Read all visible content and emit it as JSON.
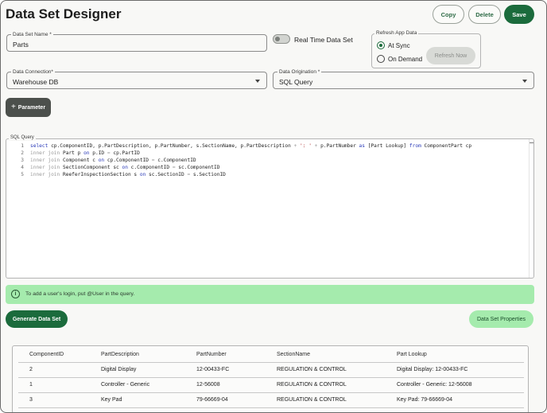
{
  "header": {
    "title": "Data Set Designer",
    "copy_label": "Copy",
    "delete_label": "Delete",
    "save_label": "Save"
  },
  "form": {
    "dataset_name": {
      "label": "Data Set Name *",
      "value": "Parts"
    },
    "realtime": {
      "label": "Real Time Data Set",
      "enabled": false
    },
    "refresh": {
      "title": "Refresh App Data",
      "options": [
        {
          "label": "At Sync",
          "selected": true
        },
        {
          "label": "On Demand",
          "selected": false
        }
      ],
      "refresh_now_label": "Refresh Now"
    },
    "data_connection": {
      "label": "Data Connection*",
      "value": "Warehouse DB"
    },
    "data_origination": {
      "label": "Data Origination *",
      "value": "SQL Query"
    },
    "parameter_button": {
      "icon": "plus-icon",
      "label": "Parameter"
    }
  },
  "sql": {
    "title": "SQL Query",
    "lines": [
      {
        "num": "1",
        "tokens": [
          {
            "t": "kw",
            "v": "select"
          },
          {
            "t": "tx",
            "v": " cp.ComponentID, p.PartDescription, p.PartNumber, s.SectionName, p.PartDescription "
          },
          {
            "t": "kw2",
            "v": "+"
          },
          {
            "t": "st",
            "v": " ': ' "
          },
          {
            "t": "kw2",
            "v": "+"
          },
          {
            "t": "tx",
            "v": " p.PartNumber "
          },
          {
            "t": "kw",
            "v": "as"
          },
          {
            "t": "tx",
            "v": " [Part Lookup] "
          },
          {
            "t": "kw",
            "v": "from"
          },
          {
            "t": "tx",
            "v": " ComponentPart cp"
          }
        ]
      },
      {
        "num": "2",
        "tokens": [
          {
            "t": "kw2",
            "v": "inner join"
          },
          {
            "t": "tx",
            "v": " Part p "
          },
          {
            "t": "kw",
            "v": "on"
          },
          {
            "t": "tx",
            "v": " p.ID "
          },
          {
            "t": "kw2",
            "v": "="
          },
          {
            "t": "tx",
            "v": " cp.PartID"
          }
        ]
      },
      {
        "num": "3",
        "tokens": [
          {
            "t": "kw2",
            "v": "inner join"
          },
          {
            "t": "tx",
            "v": " Component c "
          },
          {
            "t": "kw",
            "v": "on"
          },
          {
            "t": "tx",
            "v": " cp.ComponentID "
          },
          {
            "t": "kw2",
            "v": "="
          },
          {
            "t": "tx",
            "v": " c.ComponentID"
          }
        ]
      },
      {
        "num": "4",
        "tokens": [
          {
            "t": "kw2",
            "v": "inner join"
          },
          {
            "t": "tx",
            "v": " SectionComponent sc "
          },
          {
            "t": "kw",
            "v": "on"
          },
          {
            "t": "tx",
            "v": " c.ComponentID "
          },
          {
            "t": "kw2",
            "v": "="
          },
          {
            "t": "tx",
            "v": " sc.ComponentID"
          }
        ]
      },
      {
        "num": "5",
        "tokens": [
          {
            "t": "kw2",
            "v": "inner join"
          },
          {
            "t": "tx",
            "v": " ReeferInspectionSection s "
          },
          {
            "t": "kw",
            "v": "on"
          },
          {
            "t": "tx",
            "v": " sc.SectionID "
          },
          {
            "t": "kw2",
            "v": "="
          },
          {
            "t": "tx",
            "v": " s.SectionID"
          }
        ]
      }
    ]
  },
  "info": {
    "icon": "info-icon",
    "text": "To add a user's login, put @User in the query."
  },
  "actions": {
    "generate_label": "Generate Data Set",
    "properties_label": "Data Set Properties"
  },
  "table": {
    "columns": [
      "ComponentID",
      "PartDescription",
      "PartNumber",
      "SectionName",
      "Part Lookup"
    ],
    "rows": [
      [
        "2",
        "Digital Display",
        "12-00433-FC",
        "REGULATION & CONTROL",
        "Digital Display: 12-00433-FC"
      ],
      [
        "1",
        "Controller - Generic",
        "12-56008",
        "REGULATION & CONTROL",
        "Controller - Generic: 12-56008"
      ],
      [
        "3",
        "Key Pad",
        "79-66669-04",
        "REGULATION & CONTROL",
        "Key Pad: 79-66669-04"
      ]
    ]
  },
  "colors": {
    "primary": "#1b6b3c",
    "info_bg": "#a5ebad",
    "sql_keyword": "#2a3ab8",
    "sql_string": "#a31515"
  }
}
